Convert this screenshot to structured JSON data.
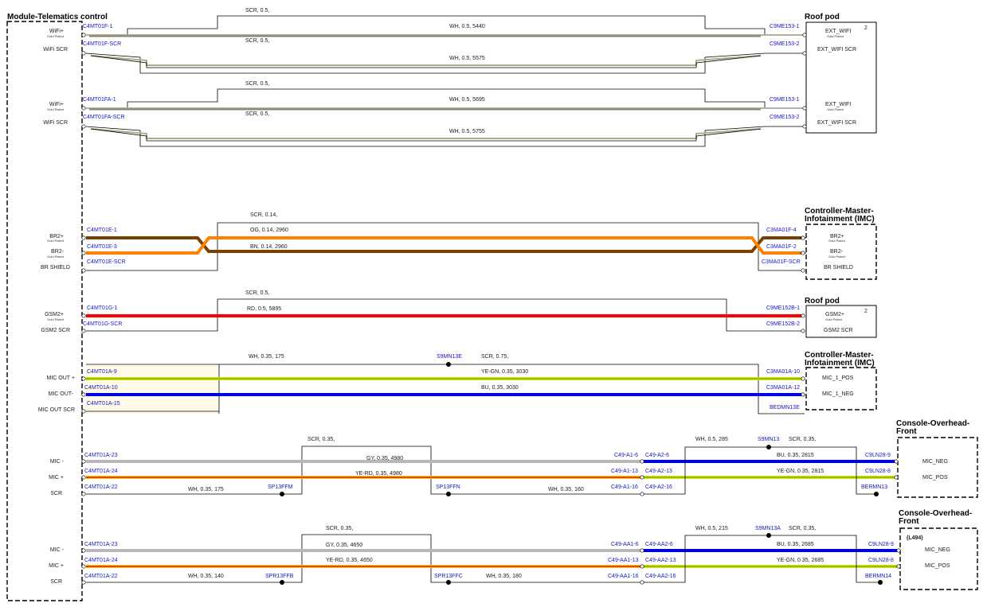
{
  "modules": {
    "telematics": "Module-Telematics control",
    "roof_pod_1": "Roof pod",
    "roof_pod_1_num": "2",
    "imc_1_line1": "Controller-Master-",
    "imc_1_line2": "Infotainment (IMC)",
    "roof_pod_2": "Roof pod",
    "roof_pod_2_num": "2",
    "imc_2_line1": "Controller-Master-",
    "imc_2_line2": "Infotainment (IMC)",
    "console_1_line1": "Console-Overhead-",
    "console_1_line2": "Front",
    "console_2_line1": "Console-Overhead-",
    "console_2_line2": "Front",
    "console_2_variant": "(L494)"
  },
  "left_pins": {
    "wifi_plus_1": "WiFi+",
    "wifi_plus_1_sub": "Gold Plated",
    "wifi_scr_1": "WiFi SCR",
    "wifi_plus_2": "WiFi+",
    "wifi_plus_2_sub": "Gold Plated",
    "wifi_scr_2": "WiFi SCR",
    "br2_plus": "BR2+",
    "br2_plus_sub": "Gold Plated",
    "br2_minus": "BR2-",
    "br2_minus_sub": "Gold Plated",
    "br_shield": "BR SHIELD",
    "gsm2_plus": "GSM2+",
    "gsm2_plus_sub": "Gold Plated",
    "gsm2_scr": "GSM2 SCR",
    "mic_out_plus": "MIC OUT +",
    "mic_out_minus": "MIC OUT-",
    "mic_out_scr": "MIC OUT SCR",
    "mic_minus_1": "MIC -",
    "mic_plus_1": "MIC +",
    "scr_1": "SCR",
    "mic_minus_2": "MIC -",
    "mic_plus_2": "MIC +",
    "scr_2": "SCR"
  },
  "right_pins": {
    "ext_wifi_1": "EXT_WIFI",
    "ext_wifi_1_sub": "Gold Plated",
    "ext_wifi_scr_1": "EXT_WIFI SCR",
    "ext_wifi_2": "EXT_WIFI",
    "ext_wifi_2_sub": "Gold Plated",
    "ext_wifi_scr_2": "EXT_WIFI SCR",
    "br2_plus": "BR2+",
    "br2_plus_sub": "Gold Plated",
    "br2_minus": "BR2-",
    "br2_minus_sub": "Gold Plated",
    "br_shield": "BR SHIELD",
    "gsm2_plus": "GSM2+",
    "gsm2_plus_sub": "Gold Plated",
    "gsm2_scr": "GSM2 SCR",
    "mic1_pos": "MIC_1_POS",
    "mic1_neg": "MIC_1_NEG",
    "mic_neg_1": "MIC_NEG",
    "mic_pos_1": "MIC_POS",
    "mic_neg_2": "MIC_NEG",
    "mic_pos_2": "MIC_POS"
  },
  "connectors": {
    "c4mt01f_1": "C4MT01F-1",
    "c4mt01f_scr": "C4MT01F-SCR",
    "c9me153_1a": "C9ME153-1",
    "c9me153_2a": "C9ME153-2",
    "c4mt01fa_1": "C4MT01FA-1",
    "c4mt01fa_scr": "C4MT01FA-SCR",
    "c9me153_1b": "C9ME153-1",
    "c9me153_2b": "C9ME153-2",
    "c4mt01e_1": "C4MT01E-1",
    "c4mt01e_3": "C4MT01E-3",
    "c4mt01e_scr": "C4MT01E-SCR",
    "c3ma01f_4": "C3MA01F-4",
    "c3ma01f_2": "C3MA01F-2",
    "c3ma01f_scr": "C3MA01F-SCR",
    "c4mt01g_1": "C4MT01G-1",
    "c4mt01g_scr": "C4MT01G-SCR",
    "c9me152b_1": "C9ME152B-1",
    "c9me152b_2": "C9ME152B-2",
    "c4mt01a_9": "C4MT01A-9",
    "c4mt01a_10": "C4MT01A-10",
    "c4mt01a_15": "C4MT01A-15",
    "s9mn13e": "S9MN13E",
    "c3ma01a_10": "C3MA01A-10",
    "c3ma01a_12": "C3MA01A-12",
    "bedmn13e": "BEDMN13E",
    "c4mt01a_23_a": "C4MT01A-23",
    "c4mt01a_24_a": "C4MT01A-24",
    "c4mt01a_22_a": "C4MT01A-22",
    "sp13ffm": "SP13FFM",
    "sp13ffn": "SP13FFN",
    "c49a1_6": "C49-A1-6",
    "c49a2_6": "C49-A2-6",
    "c49a1_13": "C49-A1-13",
    "c49a2_13": "C49-A2-13",
    "c49a1_16": "C49-A1-16",
    "c49a2_16": "C49-A2-16",
    "s9mn13": "S9MN13",
    "c9ln28_9a": "C9LN28-9",
    "c9ln28_8a": "C9LN28-8",
    "bermn13": "BERMN13",
    "c4mt01a_23_b": "C4MT01A-23",
    "c4mt01a_24_b": "C4MT01A-24",
    "c4mt01a_22_b": "C4MT01A-22",
    "spr13ffb": "SPR13FFB",
    "spr13ffc": "SPR13FFC",
    "c49aa1_6": "C49-AA1-6",
    "c49aa2_6": "C49-AA2-6",
    "c49aa1_13": "C49-AA1-13",
    "c49aa2_13": "C49-AA2-13",
    "c49aa1_16": "C49-AA1-16",
    "c49aa2_16": "C49-AA2-16",
    "s9mn13a": "S9MN13A",
    "c9ln28_9b": "C9LN28-9",
    "c9ln28_8b": "C9LN28-8",
    "bermn14": "BERMN14"
  },
  "wires": {
    "w1_scr": "SCR,  0.5,",
    "w1_wh": "WH,  0.5,  5440",
    "w2_scr": "SCR,  0.5,",
    "w2_wh": "WH,  0.5,  5575",
    "w3_scr": "SCR,  0.5,",
    "w3_wh": "WH,  0.5,  5695",
    "w4_scr": "SCR,  0.5,",
    "w4_wh": "WH,  0.5,  5755",
    "br_scr": "SCR,  0.14,",
    "br_og": "OG,  0.14,  2960",
    "br_bn": "BN,  0.14,  2960",
    "gsm_scr": "SCR,  0.5,",
    "gsm_rd": "RD,  0.5,  5895",
    "mo_wh": "WH,  0.35,  175",
    "mo_scr": "SCR,  0.75,",
    "mo_yegn": "YE-GN,  0.35,  3030",
    "mo_bu": "BU,  0.35,  3030",
    "m1_scr": "SCR,  0.35,",
    "m1_gy": "GY,  0.35,  4980",
    "m1_yerd": "YE-RD,  0.35,  4980",
    "m1_wh1": "WH,  0.35,  175",
    "m1_wh2": "WH,  0.35,  160",
    "m1_wh3": "WH,  0.5,  285",
    "m1_scr2": "SCR,  0.35,",
    "m1_bu": "BU,  0.35,  2815",
    "m1_yegn": "YE-GN,  0.35,  2815",
    "m2_scr": "SCR,  0.35,",
    "m2_gy": "GY,  0.35,  4650",
    "m2_yerd": "YE-RD,  0.35,  4650",
    "m2_wh1": "WH,  0.35,  140",
    "m2_wh2": "WH,  0.35,  180",
    "m2_wh3": "WH,  0.5,  215",
    "m2_scr2": "SCR,  0.35,",
    "m2_bu": "BU,  0.35,  2685",
    "m2_yegn": "YE-GN,  0.35,  2685"
  },
  "colors": {
    "orange": "#ff8000",
    "brown": "#7a4000",
    "red": "#ff0000",
    "blue": "#0000e6",
    "grey": "#b8b8b8",
    "yellow": "#f2d600",
    "green": "#55c400",
    "shield_tan": "#a6a07a"
  }
}
